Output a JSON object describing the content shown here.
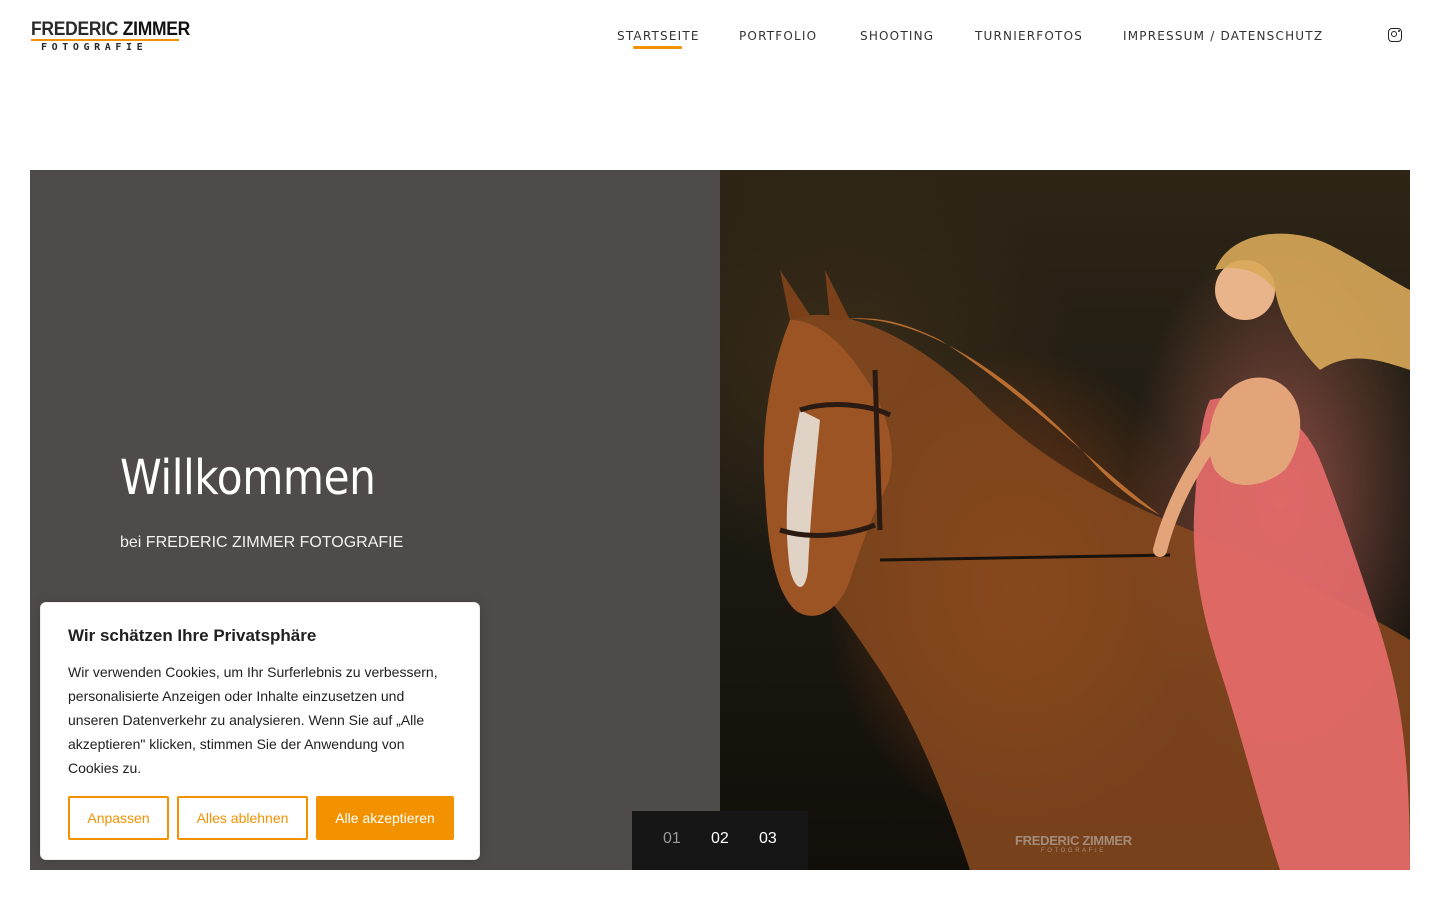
{
  "header": {
    "logo": {
      "name": "FREDERIC ZIMMER",
      "name_first": "FREDERIC",
      "name_last": "ZIMMER",
      "tagline": "FOTOGRAFIE"
    },
    "nav": [
      {
        "label": "STARTSEITE",
        "active": true
      },
      {
        "label": "PORTFOLIO",
        "active": false
      },
      {
        "label": "SHOOTING",
        "active": false
      },
      {
        "label": "TURNIERFOTOS",
        "active": false
      },
      {
        "label": "IMPRESSUM / DATENSCHUTZ",
        "active": false
      }
    ],
    "social_icon": "instagram-icon"
  },
  "hero": {
    "title": "Willkommen",
    "subtitle": "bei FREDERIC ZIMMER FOTOGRAFIE",
    "image": "horse-rider-photo",
    "watermark": {
      "top": "FREDERIC ZIMMER",
      "bottom": "FOTOGRAFIE"
    },
    "slides": [
      "01",
      "02",
      "03"
    ],
    "active_slide": "01"
  },
  "cookie_banner": {
    "title": "Wir schätzen Ihre Privatsphäre",
    "text": "Wir verwenden Cookies, um Ihr Surferlebnis zu verbessern, personalisierte Anzeigen oder Inhalte einzusetzen und unseren Datenverkehr zu analysieren. Wenn Sie auf „Alle akzeptieren\" klicken, stimmen Sie der Anwendung von Cookies zu.",
    "buttons": {
      "customize": "Anpassen",
      "reject": "Alles ablehnen",
      "accept": "Alle akzeptieren"
    }
  },
  "colors": {
    "accent": "#f39200",
    "hero_panel": "#4f4b4a",
    "text_dark": "#212121"
  }
}
